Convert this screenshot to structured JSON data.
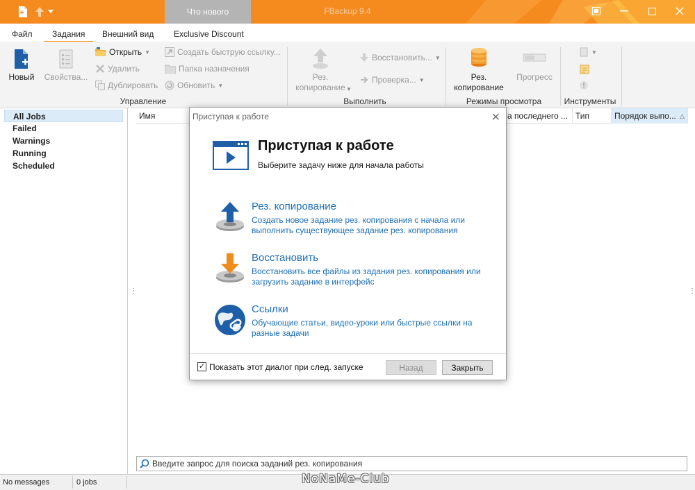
{
  "window": {
    "title": "FBackup 9.4",
    "whats_new_tab": "Что нового",
    "accent_color": "#f58b1f"
  },
  "menu": {
    "items": [
      "Файл",
      "Задания",
      "Внешний вид",
      "Exclusive Discount"
    ],
    "active": "Задания"
  },
  "ribbon": {
    "new_label": "Новый",
    "properties_label": "Свойства...",
    "open_label": "Открыть",
    "delete_label": "Удалить",
    "duplicate_label": "Дублировать",
    "create_shortcut_label": "Создать быструю ссылку...",
    "destination_folder_label": "Папка назначения",
    "refresh_label": "Обновить",
    "backup_label_line1": "Рез.",
    "backup_label_line2": "копирование",
    "restore_label": "Восстановить...",
    "check_label": "Проверка...",
    "view_backup_line1": "Рез.",
    "view_backup_line2": "копирование",
    "progress_label": "Прогресс",
    "group_manage": "Управление",
    "group_execute": "Выполнить",
    "group_view_modes": "Режимы просмотра",
    "group_tools": "Инструменты"
  },
  "sidebar": {
    "items": [
      "All Jobs",
      "Failed",
      "Warnings",
      "Running",
      "Scheduled"
    ],
    "selected": "All Jobs"
  },
  "columns": [
    "Имя",
    "а последнего ...",
    "Тип",
    "Порядок выпо..."
  ],
  "search": {
    "placeholder": "Введите запрос для поиска заданий рез. копирования"
  },
  "status": {
    "messages": "No messages",
    "jobs": "0 jobs"
  },
  "watermark": "NoNaMe-Club",
  "dialog": {
    "title": "Приступая к работе",
    "heading": "Приступая к работе",
    "subtitle": "Выберите задачу ниже для начала работы",
    "options": [
      {
        "title": "Рез. копирование",
        "desc_line1": "Создать новое задание рез. копирования с начала или",
        "desc_line2": "выполнить существующее задание рез. копирования"
      },
      {
        "title": "Восстановить",
        "desc_line1": "Восстановить все файлы из задания рез. копирования или",
        "desc_line2": "загрузить задание в интерфейс"
      },
      {
        "title": "Ссылки",
        "desc_line1": "Обучающие статьи, видео-уроки или быстрые ссылки на",
        "desc_line2": "разные задачи"
      }
    ],
    "show_on_startup_label": "Показать этот диалог при след. запуске",
    "show_on_startup_checked": true,
    "back_button": "Назад",
    "close_button": "Закрыть"
  }
}
